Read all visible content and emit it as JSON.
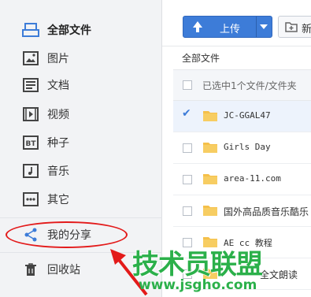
{
  "sidebar": {
    "items": [
      {
        "label": "全部文件",
        "icon": "all-files-icon"
      },
      {
        "label": "图片",
        "icon": "image-icon"
      },
      {
        "label": "文档",
        "icon": "document-icon"
      },
      {
        "label": "视频",
        "icon": "video-icon"
      },
      {
        "label": "种子",
        "icon": "bt-torrent-icon",
        "icon_text": "BT"
      },
      {
        "label": "音乐",
        "icon": "music-icon"
      },
      {
        "label": "其它",
        "icon": "more-icon"
      },
      {
        "label": "我的分享",
        "icon": "share-icon"
      },
      {
        "label": "回收站",
        "icon": "trash-icon"
      }
    ]
  },
  "toolbar": {
    "upload_label": "上传",
    "newfolder_label": "新建"
  },
  "main": {
    "breadcrumb": "全部文件",
    "selection_text": "已选中1个文件/文件夹",
    "files": [
      {
        "name": "JC-GGAL47",
        "selected": true
      },
      {
        "name": "Girls Day",
        "selected": false
      },
      {
        "name": "area-11.com",
        "selected": false
      },
      {
        "name": "国外高品质音乐酷乐",
        "selected": false
      },
      {
        "name": "AE cc 教程",
        "selected": false
      },
      {
        "name": "全文朗读",
        "selected": false
      }
    ]
  },
  "watermark": {
    "text": "技术员联盟",
    "url": "www.jsgho.com"
  },
  "colors": {
    "accent": "#3d7cd8",
    "annotation": "#e31a1a",
    "watermark": "#2bb04a",
    "folder": "#f5c04a"
  }
}
